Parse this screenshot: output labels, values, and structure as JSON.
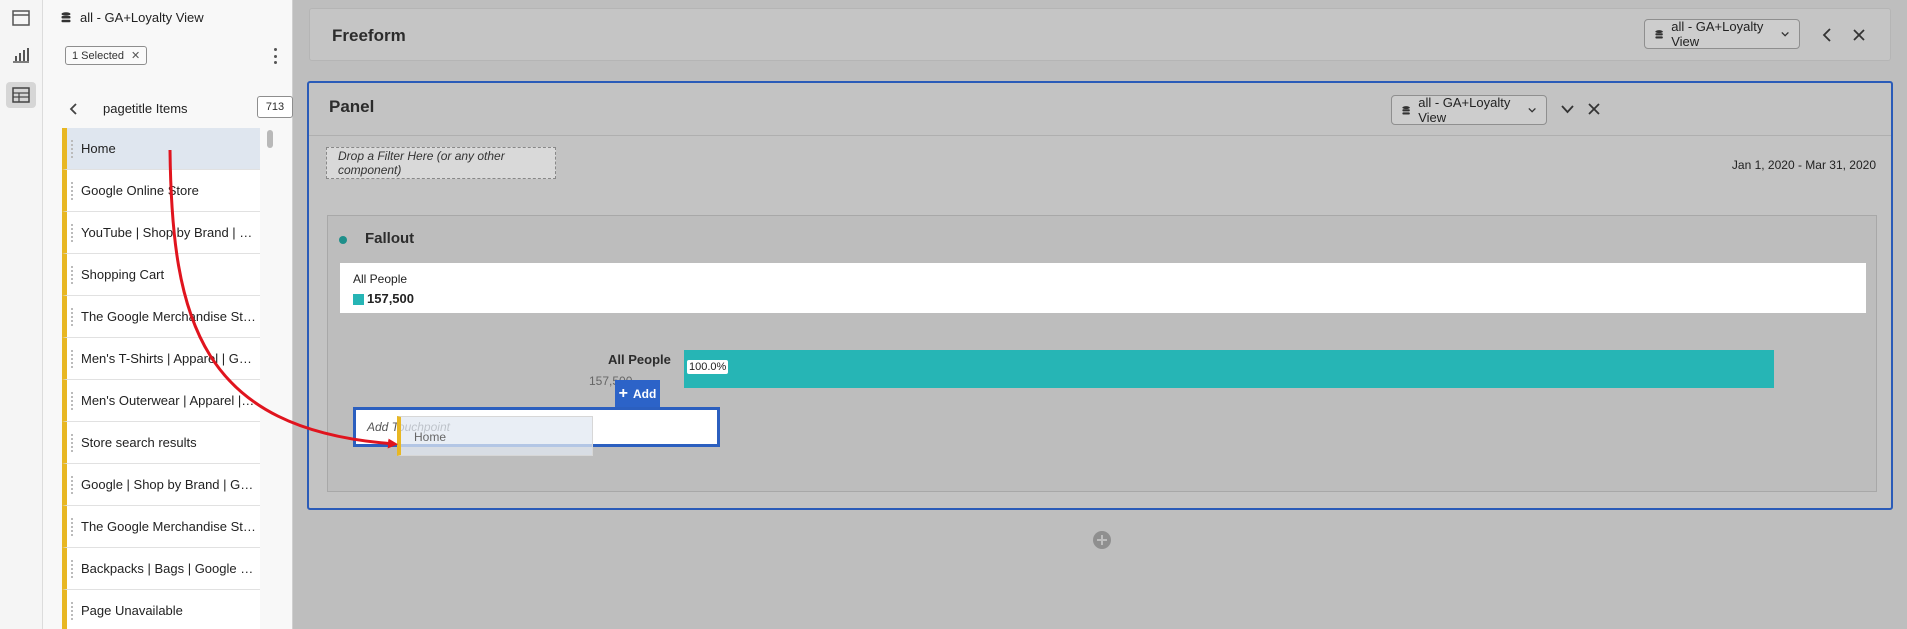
{
  "rail": {
    "icons": [
      "panel-icon",
      "chart-icon",
      "table-icon"
    ]
  },
  "components": {
    "report_suite": "all - GA+Loyalty View",
    "selected_label": "1 Selected",
    "items_title": "pagetitle Items",
    "items_count": "713",
    "items": [
      "Home",
      "Google Online Store",
      "YouTube | Shop by Brand | Google Merchandise Store",
      "Shopping Cart",
      "The Google Merchandise Store",
      "Men's T-Shirts | Apparel | Google Merchandise Store",
      "Men's Outerwear | Apparel | Google Merchandise Store",
      "Store search results",
      "Google | Shop by Brand | Google Merchandise Store",
      "The Google Merchandise Store",
      "Backpacks | Bags | Google Merchandise Store",
      "Page Unavailable"
    ]
  },
  "freeform": {
    "title": "Freeform",
    "report_suite": "all - GA+Loyalty View"
  },
  "panel": {
    "title": "Panel",
    "report_suite": "all - GA+Loyalty View",
    "filter_placeholder": "Drop a Filter Here (or any other component)",
    "date_range": "Jan 1, 2020 - Mar 31, 2020"
  },
  "fallout": {
    "title": "Fallout",
    "legend_name": "All People",
    "legend_value": "157,500",
    "touchpoint_label": "All People",
    "touchpoint_sub": "157,500",
    "bar_percent_label": "100.0%",
    "bar_fraction": 1.0,
    "add_label": "Add",
    "touchpoint_placeholder": "Add Touchpoint",
    "drag_ghost_label": "Home"
  },
  "colors": {
    "accent_teal": "#26b5b5",
    "panel_blue": "#2a5bb8",
    "item_yellow": "#e8b723",
    "arrow_red": "#e0141e"
  }
}
